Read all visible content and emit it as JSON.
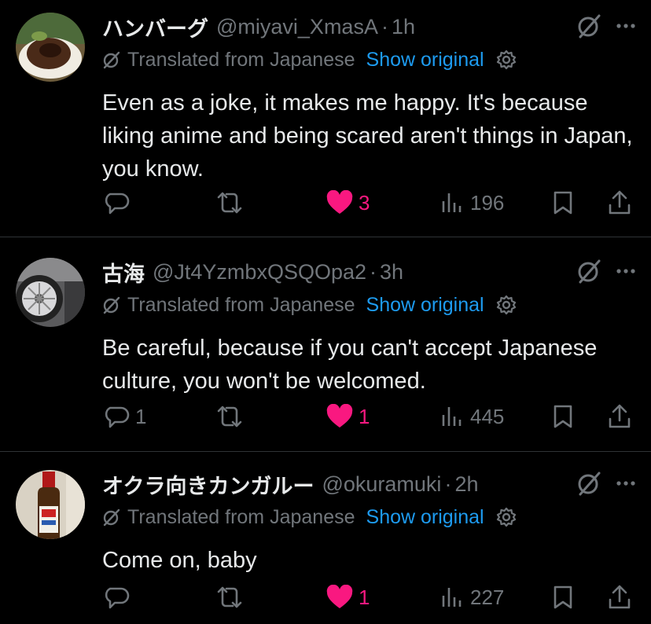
{
  "tweets": [
    {
      "name": "ハンバーグ",
      "handle": "@miyavi_XmasA",
      "sep": "·",
      "time": "1h",
      "translated_label": "Translated from Japanese",
      "show_original": "Show original",
      "text": "Even as a joke, it makes me happy. It's because liking anime and being scared aren't things in Japan, you know.",
      "replies": "",
      "likes": "3",
      "views": "196",
      "avatar": "hamburger-photo"
    },
    {
      "name": "古海",
      "handle": "@Jt4YzmbxQSQOpa2",
      "sep": "·",
      "time": "3h",
      "translated_label": "Translated from Japanese",
      "show_original": "Show original",
      "text": "Be careful, because if you can't accept Japanese culture, you won't be welcomed.",
      "replies": "1",
      "likes": "1",
      "views": "445",
      "avatar": "car-wheel-photo"
    },
    {
      "name": "オクラ向きカンガルー",
      "handle": "@okuramuki",
      "sep": "·",
      "time": "2h",
      "translated_label": "Translated from Japanese",
      "show_original": "Show original",
      "text": "Come on, baby",
      "replies": "",
      "likes": "1",
      "views": "227",
      "avatar": "sauce-bottle-photo"
    }
  ],
  "colors": {
    "background": "#000000",
    "text": "#e7e9ea",
    "muted": "#71767b",
    "link": "#1d9bf0",
    "like": "#f91880",
    "divider": "#2f3336"
  },
  "icons": [
    "reply-icon",
    "retweet-icon",
    "like-icon",
    "views-icon",
    "bookmark-icon",
    "share-icon",
    "grok-icon",
    "more-icon",
    "translate-icon",
    "settings-icon"
  ]
}
